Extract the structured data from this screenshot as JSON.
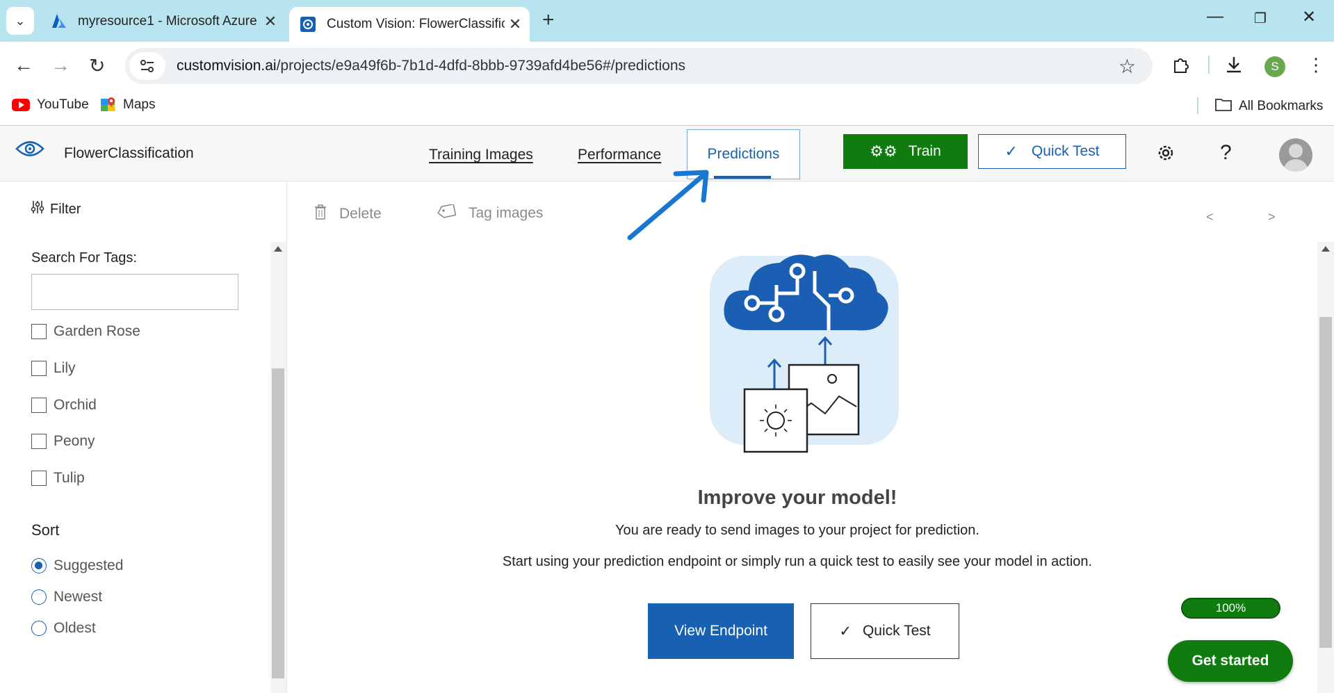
{
  "browser": {
    "tabs": [
      {
        "title": "myresource1 - Microsoft Azure",
        "active": false
      },
      {
        "title": "Custom Vision: FlowerClassifica",
        "active": true
      }
    ],
    "url_host": "customvision.ai",
    "url_path": "/projects/e9a49f6b-7b1d-4dfd-8bbb-9739afd4be56#/predictions",
    "profile_initial": "S",
    "bookmarks": [
      "YouTube",
      "Maps"
    ],
    "all_bookmarks_label": "All Bookmarks"
  },
  "header": {
    "project_name": "FlowerClassification",
    "nav": [
      "Training Images",
      "Performance",
      "Predictions"
    ],
    "train_label": "Train",
    "quick_test_label": "Quick Test",
    "help_label": "?"
  },
  "sidebar": {
    "filter_label": "Filter",
    "search_label": "Search For Tags:",
    "search_value": "",
    "tags": [
      "Garden Rose",
      "Lily",
      "Orchid",
      "Peony",
      "Tulip"
    ],
    "sort_label": "Sort",
    "sort_options": [
      "Suggested",
      "Newest",
      "Oldest"
    ],
    "sort_selected": "Suggested"
  },
  "main": {
    "delete_label": "Delete",
    "tag_images_label": "Tag images",
    "pager_prev": "<",
    "pager_next": ">",
    "headline": "Improve your model!",
    "line1": "You are ready to send images to your project for prediction.",
    "line2": "Start using your prediction endpoint or simply run a quick test to easily see your model in action.",
    "view_endpoint_label": "View Endpoint",
    "quick_test_label": "Quick Test",
    "progress_label": "100%",
    "progress_value": 1.0,
    "get_started_label": "Get started"
  },
  "colors": {
    "accent_blue": "#1760b2",
    "train_green": "#107c10",
    "tabbar": "#b8e4ef"
  }
}
